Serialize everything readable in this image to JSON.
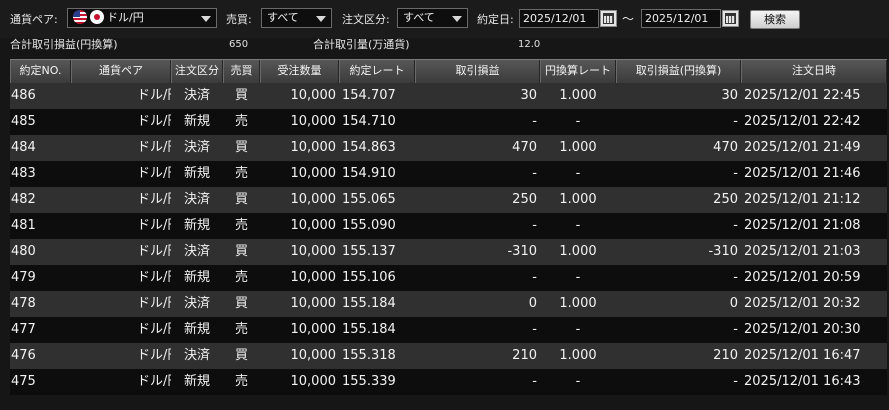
{
  "filters": {
    "pair_label": "通貨ペア:",
    "pair_value": "ドル/円",
    "side_label": "売買:",
    "side_value": "すべて",
    "order_type_label": "注文区分:",
    "order_type_value": "すべて",
    "date_label": "約定日:",
    "date_from": "2025/12/01",
    "date_sep": "～",
    "date_to": "2025/12/01",
    "search_label": "検索"
  },
  "summary": {
    "total_pl_label": "合計取引損益(円換算)",
    "total_pl_value": "650",
    "total_volume_label": "合計取引量(万通貨)",
    "total_volume_value": "12.0"
  },
  "table": {
    "columns": [
      "約定NO.",
      "通貨ペア",
      "注文区分",
      "売買",
      "受注数量",
      "約定レート",
      "取引損益",
      "円換算レート",
      "取引損益(円換算)",
      "注文日時"
    ],
    "rows": [
      [
        "486",
        "ドル/円",
        "決済",
        "買",
        "10,000",
        "154.707",
        "30",
        "1.000",
        "30",
        "2025/12/01 22:45"
      ],
      [
        "485",
        "ドル/円",
        "新規",
        "売",
        "10,000",
        "154.710",
        "-",
        "-",
        "-",
        "2025/12/01 22:42"
      ],
      [
        "484",
        "ドル/円",
        "決済",
        "買",
        "10,000",
        "154.863",
        "470",
        "1.000",
        "470",
        "2025/12/01 21:49"
      ],
      [
        "483",
        "ドル/円",
        "新規",
        "売",
        "10,000",
        "154.910",
        "-",
        "-",
        "-",
        "2025/12/01 21:46"
      ],
      [
        "482",
        "ドル/円",
        "決済",
        "買",
        "10,000",
        "155.065",
        "250",
        "1.000",
        "250",
        "2025/12/01 21:12"
      ],
      [
        "481",
        "ドル/円",
        "新規",
        "売",
        "10,000",
        "155.090",
        "-",
        "-",
        "-",
        "2025/12/01 21:08"
      ],
      [
        "480",
        "ドル/円",
        "決済",
        "買",
        "10,000",
        "155.137",
        "-310",
        "1.000",
        "-310",
        "2025/12/01 21:03"
      ],
      [
        "479",
        "ドル/円",
        "新規",
        "売",
        "10,000",
        "155.106",
        "-",
        "-",
        "-",
        "2025/12/01 20:59"
      ],
      [
        "478",
        "ドル/円",
        "決済",
        "買",
        "10,000",
        "155.184",
        "0",
        "1.000",
        "0",
        "2025/12/01 20:32"
      ],
      [
        "477",
        "ドル/円",
        "新規",
        "売",
        "10,000",
        "155.184",
        "-",
        "-",
        "-",
        "2025/12/01 20:30"
      ],
      [
        "476",
        "ドル/円",
        "決済",
        "買",
        "10,000",
        "155.318",
        "210",
        "1.000",
        "210",
        "2025/12/01 16:47"
      ],
      [
        "475",
        "ドル/円",
        "新規",
        "売",
        "10,000",
        "155.339",
        "-",
        "-",
        "-",
        "2025/12/01 16:43"
      ]
    ]
  },
  "icons": {
    "flag_us": "us-flag-icon",
    "flag_jp": "jp-flag-icon",
    "calendar": "calendar-icon",
    "dropdown": "chevron-down-icon"
  }
}
